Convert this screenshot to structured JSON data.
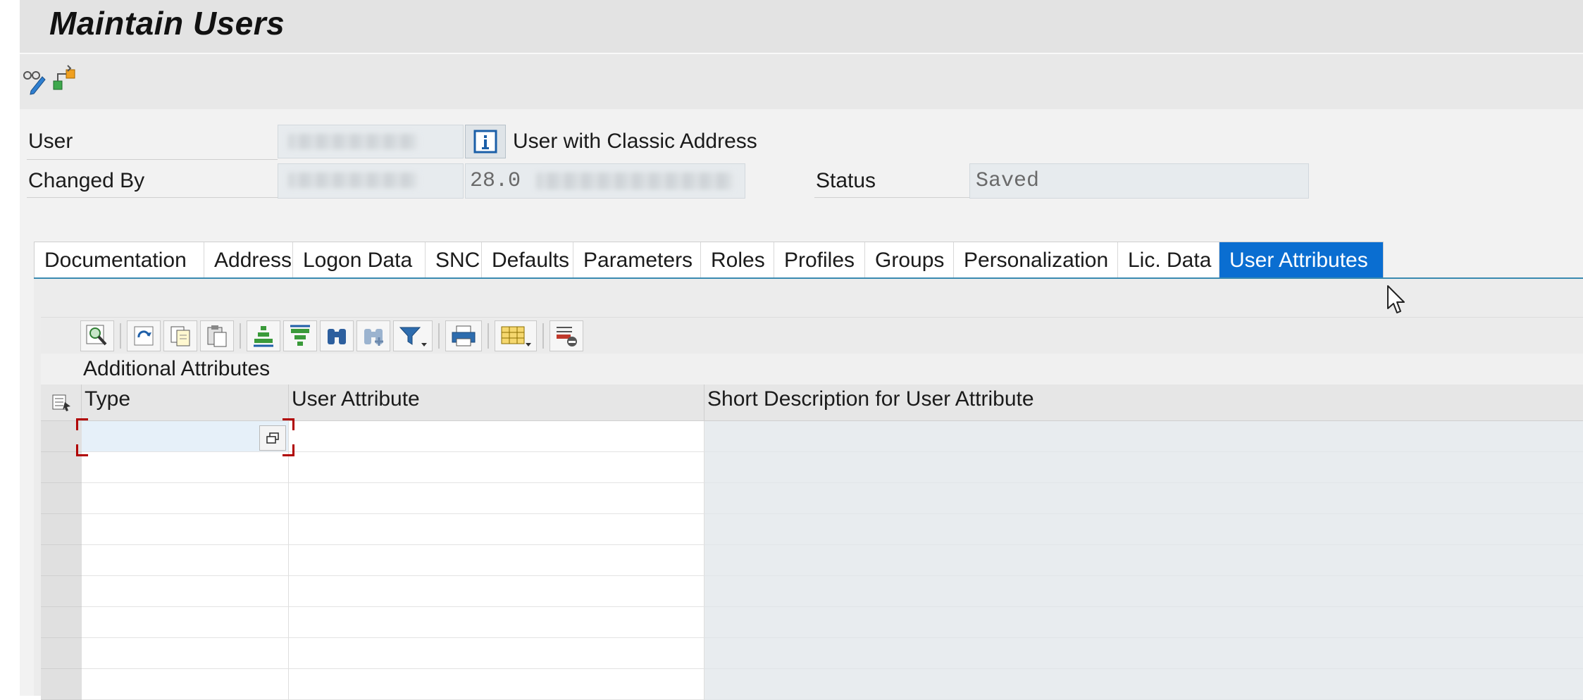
{
  "window": {
    "title": "Maintain Users"
  },
  "toolbar": {
    "icons": [
      "glasses-pencil-icon",
      "hierarchy-icon"
    ]
  },
  "header": {
    "user_label": "User",
    "user_value": "",
    "user_info_text": "User with Classic Address",
    "changed_by_label": "Changed By",
    "changed_by_value": "",
    "changed_on_value": "28.0",
    "status_label": "Status",
    "status_value": "Saved"
  },
  "tabs": [
    {
      "label": "Documentation"
    },
    {
      "label": "Address"
    },
    {
      "label": "Logon Data"
    },
    {
      "label": "SNC"
    },
    {
      "label": "Defaults"
    },
    {
      "label": "Parameters"
    },
    {
      "label": "Roles"
    },
    {
      "label": "Profiles"
    },
    {
      "label": "Groups"
    },
    {
      "label": "Personalization"
    },
    {
      "label": "Lic. Data"
    },
    {
      "label": "User Attributes",
      "active": true
    }
  ],
  "grid": {
    "title": "Additional Attributes",
    "columns": [
      "Type",
      "User Attribute",
      "Short Description for User Attribute"
    ],
    "rows": [
      [
        "",
        "",
        ""
      ],
      [
        "",
        "",
        ""
      ],
      [
        "",
        "",
        ""
      ],
      [
        "",
        "",
        ""
      ],
      [
        "",
        "",
        ""
      ],
      [
        "",
        "",
        ""
      ],
      [
        "",
        "",
        ""
      ],
      [
        "",
        "",
        ""
      ],
      [
        "",
        "",
        ""
      ]
    ]
  },
  "colors": {
    "active_tab": "#0a6ed1",
    "focus_corner": "#b00000"
  }
}
